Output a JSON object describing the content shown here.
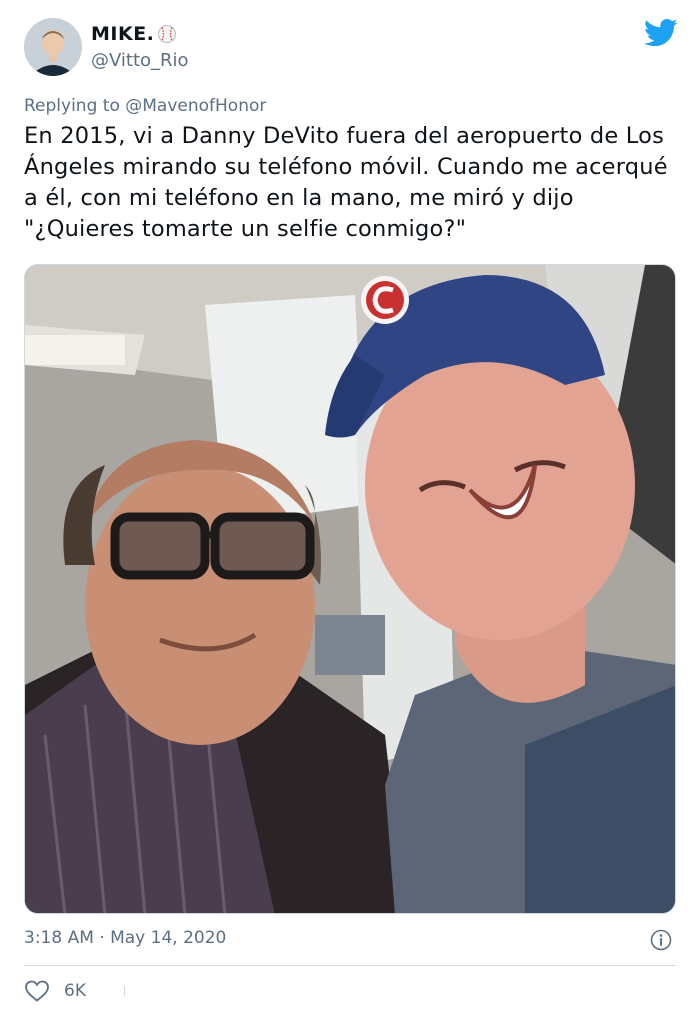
{
  "author": {
    "display_name": "MIKE.",
    "handle": "@Vitto_Rio",
    "badge_icon": "baseball-icon"
  },
  "brand": {
    "logo_icon": "twitter-bird-icon",
    "color": "#1da1f2"
  },
  "reply": {
    "prefix": "Replying to",
    "target": "@MavenofHonor"
  },
  "tweet": {
    "text": "En 2015, vi a Danny DeVito fuera del aeropuerto de Los Ángeles mirando su teléfono móvil. Cuando me acerqué a él, con mi teléfono en la mano, me miró y dijo \"¿Quieres tomarte un selfie conmigo?\"",
    "image_icon": "selfie-photo"
  },
  "footer": {
    "timestamp": "3:18 AM · May 14, 2020",
    "info_icon": "info-icon",
    "like_icon": "heart-icon",
    "like_count": "6K"
  },
  "colors": {
    "text": "#0f1419",
    "secondary": "#5b7083",
    "divider": "#cfd9de"
  }
}
